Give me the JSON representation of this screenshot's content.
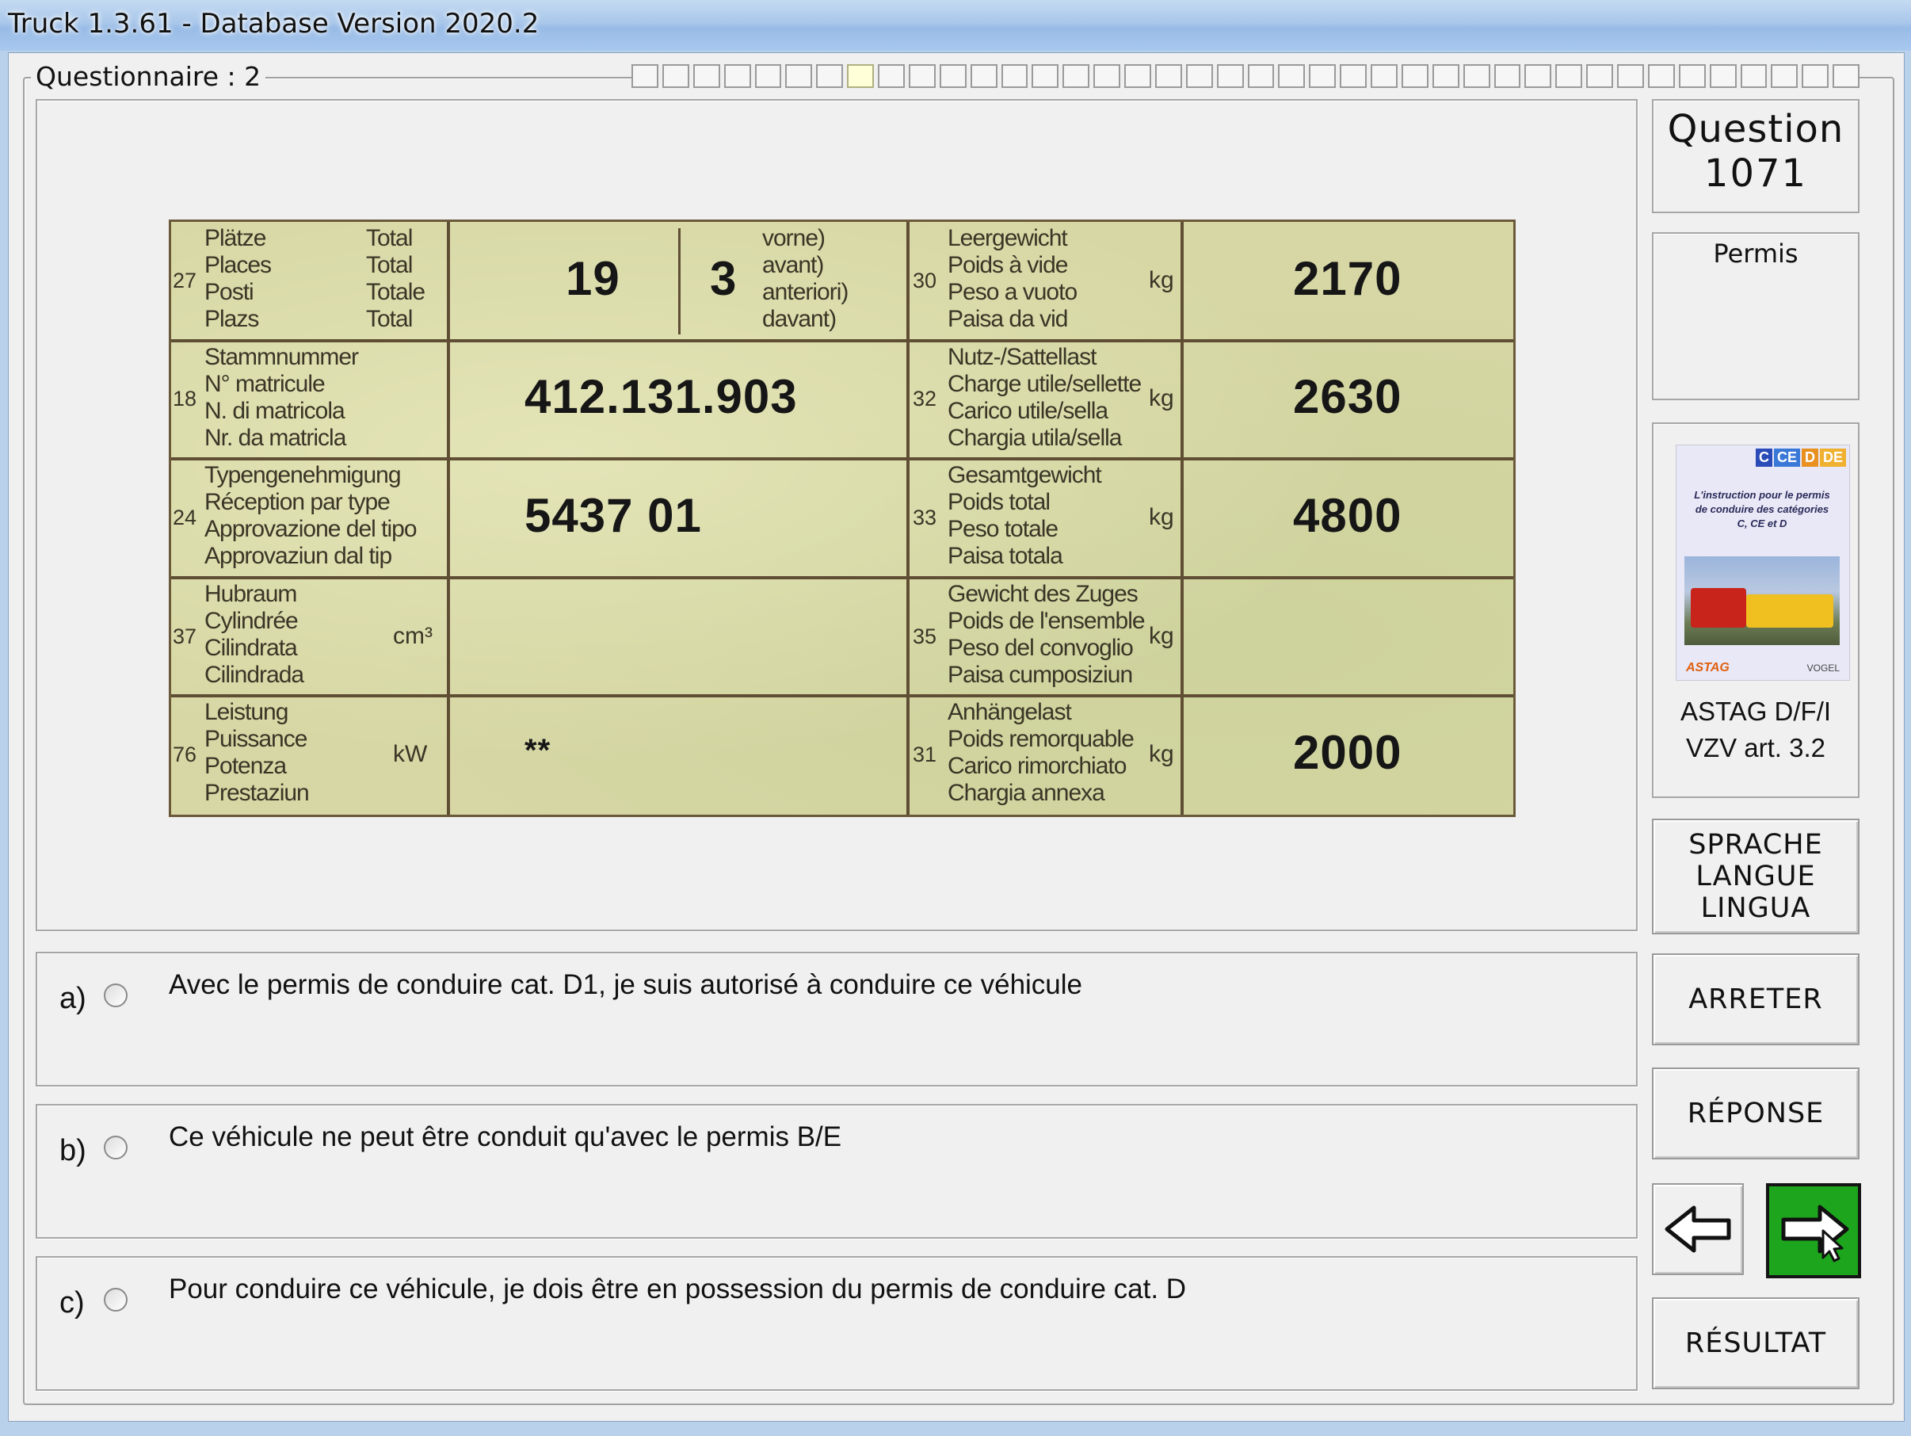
{
  "window": {
    "title": "Truck 1.3.61 - Database Version 2020.2"
  },
  "questionnaire": {
    "label": "Questionnaire : 2",
    "progress_total": 40,
    "progress_current": 8
  },
  "document": {
    "rows": [
      {
        "left_no": "27",
        "left_labels": [
          "Plätze",
          "Places",
          "Posti",
          "Plazs"
        ],
        "left_suffix": [
          "Total",
          "Total",
          "Totale",
          "Total"
        ],
        "left_unit": "",
        "value_main": "19",
        "value_second": "3",
        "value_second_labels": [
          "vorne)",
          "avant)",
          "anteriori)",
          "davant)"
        ],
        "right_no": "30",
        "right_labels": [
          "Leergewicht",
          "Poids à vide",
          "Peso a vuoto",
          "Paisa da vid"
        ],
        "right_unit": "kg",
        "right_value": "2170"
      },
      {
        "left_no": "18",
        "left_labels": [
          "Stammnummer",
          "N° matricule",
          "N. di matricola",
          "Nr. da matricla"
        ],
        "left_suffix": [],
        "left_unit": "",
        "value_main": "412.131.903",
        "right_no": "32",
        "right_labels": [
          "Nutz-/Sattellast",
          "Charge utile/sellette",
          "Carico utile/sella",
          "Chargia utila/sella"
        ],
        "right_unit": "kg",
        "right_value": "2630"
      },
      {
        "left_no": "24",
        "left_labels": [
          "Typengenehmigung",
          "Réception par type",
          "Approvazione del tipo",
          "Approvaziun dal tip"
        ],
        "left_suffix": [],
        "left_unit": "",
        "value_main": "5437 01",
        "right_no": "33",
        "right_labels": [
          "Gesamtgewicht",
          "Poids total",
          "Peso totale",
          "Paisa totala"
        ],
        "right_unit": "kg",
        "right_value": "4800"
      },
      {
        "left_no": "37",
        "left_labels": [
          "Hubraum",
          "Cylindrée",
          "Cilindrata",
          "Cilindrada"
        ],
        "left_suffix": [],
        "left_unit": "cm³",
        "value_main": "",
        "right_no": "35",
        "right_labels": [
          "Gewicht des Zuges",
          "Poids de l'ensemble",
          "Peso del convoglio",
          "Paisa cumposiziun"
        ],
        "right_unit": "kg",
        "right_value": ""
      },
      {
        "left_no": "76",
        "left_labels": [
          "Leistung",
          "Puissance",
          "Potenza",
          "Prestaziun"
        ],
        "left_suffix": [],
        "left_unit": "kW",
        "value_main": "**",
        "right_no": "31",
        "right_labels": [
          "Anhängelast",
          "Poids remorquable",
          "Carico rimorchiato",
          "Chargia annexa"
        ],
        "right_unit": "kg",
        "right_value": "2000"
      }
    ]
  },
  "answers": [
    {
      "letter": "a)",
      "text": "Avec le permis de conduire cat. D1, je suis autorisé à conduire ce véhicule"
    },
    {
      "letter": "b)",
      "text": "Ce véhicule ne peut être conduit qu'avec le permis B/E"
    },
    {
      "letter": "c)",
      "text": "Pour conduire ce véhicule, je dois être en possession du permis de conduire cat. D"
    }
  ],
  "sidebar": {
    "question_label": "Question",
    "question_number": "1071",
    "category": "Permis",
    "book": {
      "badges": [
        "C",
        "CE",
        "D",
        "DE"
      ],
      "cover_text": "L'instruction pour le permis de conduire des catégories C, CE et D",
      "publisher_left": "ASTAG",
      "publisher_right": "VOGEL",
      "caption_line1": "ASTAG D/F/I",
      "caption_line2": "VZV art. 3.2"
    },
    "buttons": {
      "language": [
        "SPRACHE",
        "LANGUE",
        "LINGUA"
      ],
      "stop": "ARRETER",
      "answer": "RÉPONSE",
      "result": "RÉSULTAT"
    }
  },
  "colors": {
    "next_button": "#1ea51e",
    "document_paper": "#d6d7a4",
    "progress_current": "#ffffd8"
  }
}
